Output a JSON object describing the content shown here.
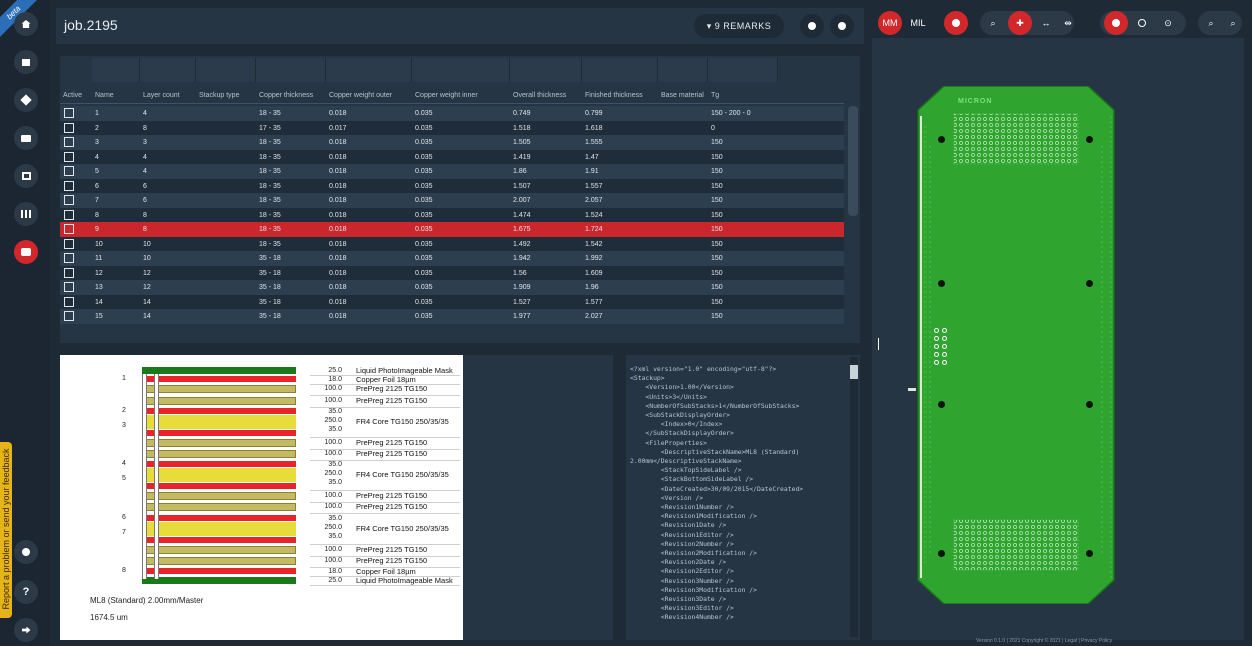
{
  "app": {
    "beta_label": "beta",
    "feedback_label": "Report a problem or send your feedback"
  },
  "sidebar": {
    "items": [
      {
        "icon": "home-icon"
      },
      {
        "icon": "document-icon"
      },
      {
        "icon": "layers-icon"
      },
      {
        "icon": "briefcase-icon"
      },
      {
        "icon": "board-icon"
      },
      {
        "icon": "grid-icon"
      },
      {
        "icon": "stackup-icon",
        "active": true
      }
    ],
    "bottom": [
      {
        "icon": "gear-icon"
      },
      {
        "icon": "help-icon",
        "label": "?"
      },
      {
        "icon": "logout-icon"
      }
    ]
  },
  "header": {
    "title": "job.2195",
    "remarks_label": "9 REMARKS"
  },
  "table": {
    "columns": [
      "Active",
      "Name",
      "Layer count",
      "Stackup type",
      "Copper thickness",
      "Copper weight outer",
      "Copper weight inner",
      "Overall thickness",
      "Finished thickness",
      "Base material",
      "Tg"
    ],
    "rows": [
      {
        "name": "1",
        "layers": "4",
        "stype": "",
        "cu_thk": "18 - 35",
        "cu_outer": "0.018",
        "cu_inner": "0.035",
        "overall": "0.749",
        "finished": "0.799",
        "base": "",
        "tg": "150 - 200 - 0"
      },
      {
        "name": "2",
        "layers": "8",
        "stype": "",
        "cu_thk": "17 - 35",
        "cu_outer": "0.017",
        "cu_inner": "0.035",
        "overall": "1.518",
        "finished": "1.618",
        "base": "",
        "tg": "0"
      },
      {
        "name": "3",
        "layers": "3",
        "stype": "",
        "cu_thk": "18 - 35",
        "cu_outer": "0.018",
        "cu_inner": "0.035",
        "overall": "1.505",
        "finished": "1.555",
        "base": "",
        "tg": "150"
      },
      {
        "name": "4",
        "layers": "4",
        "stype": "",
        "cu_thk": "18 - 35",
        "cu_outer": "0.018",
        "cu_inner": "0.035",
        "overall": "1.419",
        "finished": "1.47",
        "base": "",
        "tg": "150"
      },
      {
        "name": "5",
        "layers": "4",
        "stype": "",
        "cu_thk": "18 - 35",
        "cu_outer": "0.018",
        "cu_inner": "0.035",
        "overall": "1.86",
        "finished": "1.91",
        "base": "",
        "tg": "150"
      },
      {
        "name": "6",
        "layers": "6",
        "stype": "",
        "cu_thk": "18 - 35",
        "cu_outer": "0.018",
        "cu_inner": "0.035",
        "overall": "1.507",
        "finished": "1.557",
        "base": "",
        "tg": "150"
      },
      {
        "name": "7",
        "layers": "6",
        "stype": "",
        "cu_thk": "18 - 35",
        "cu_outer": "0.018",
        "cu_inner": "0.035",
        "overall": "2.007",
        "finished": "2.057",
        "base": "",
        "tg": "150"
      },
      {
        "name": "8",
        "layers": "8",
        "stype": "",
        "cu_thk": "18 - 35",
        "cu_outer": "0.018",
        "cu_inner": "0.035",
        "overall": "1.474",
        "finished": "1.524",
        "base": "",
        "tg": "150"
      },
      {
        "name": "9",
        "layers": "8",
        "stype": "",
        "cu_thk": "18 - 35",
        "cu_outer": "0.018",
        "cu_inner": "0.035",
        "overall": "1.675",
        "finished": "1.724",
        "base": "",
        "tg": "150",
        "selected": true
      },
      {
        "name": "10",
        "layers": "10",
        "stype": "",
        "cu_thk": "18 - 35",
        "cu_outer": "0.018",
        "cu_inner": "0.035",
        "overall": "1.492",
        "finished": "1.542",
        "base": "",
        "tg": "150"
      },
      {
        "name": "11",
        "layers": "10",
        "stype": "",
        "cu_thk": "35 - 18",
        "cu_outer": "0.018",
        "cu_inner": "0.035",
        "overall": "1.942",
        "finished": "1.992",
        "base": "",
        "tg": "150"
      },
      {
        "name": "12",
        "layers": "12",
        "stype": "",
        "cu_thk": "35 - 18",
        "cu_outer": "0.018",
        "cu_inner": "0.035",
        "overall": "1.56",
        "finished": "1.609",
        "base": "",
        "tg": "150"
      },
      {
        "name": "13",
        "layers": "12",
        "stype": "",
        "cu_thk": "35 - 18",
        "cu_outer": "0.018",
        "cu_inner": "0.035",
        "overall": "1.909",
        "finished": "1.96",
        "base": "",
        "tg": "150"
      },
      {
        "name": "14",
        "layers": "14",
        "stype": "",
        "cu_thk": "35 - 18",
        "cu_outer": "0.018",
        "cu_inner": "0.035",
        "overall": "1.527",
        "finished": "1.577",
        "base": "",
        "tg": "150"
      },
      {
        "name": "15",
        "layers": "14",
        "stype": "",
        "cu_thk": "35 - 18",
        "cu_outer": "0.018",
        "cu_inner": "0.035",
        "overall": "1.977",
        "finished": "2.027",
        "base": "",
        "tg": "150"
      }
    ]
  },
  "stackup": {
    "layers": [
      {
        "kind": "mask",
        "thickness": "25.0",
        "material": "Liquid PhotoImageable Mask"
      },
      {
        "kind": "copper",
        "num": "1",
        "thickness": "18.0",
        "material": "Copper Foil 18µm"
      },
      {
        "kind": "pp",
        "thickness": "100.0",
        "material": "PrePreg 2125 TG150"
      },
      {
        "kind": "pp",
        "thickness": "100.0",
        "material": "PrePreg 2125 TG150"
      },
      {
        "kind": "core",
        "nums": [
          "2",
          "3"
        ],
        "thickness": [
          "35.0",
          "250.0",
          "35.0"
        ],
        "material": "FR4 Core TG150 250/35/35"
      },
      {
        "kind": "pp",
        "thickness": "100.0",
        "material": "PrePreg 2125 TG150"
      },
      {
        "kind": "pp",
        "thickness": "100.0",
        "material": "PrePreg 2125 TG150"
      },
      {
        "kind": "core",
        "nums": [
          "4",
          "5"
        ],
        "thickness": [
          "35.0",
          "250.0",
          "35.0"
        ],
        "material": "FR4 Core TG150 250/35/35"
      },
      {
        "kind": "pp",
        "thickness": "100.0",
        "material": "PrePreg 2125 TG150"
      },
      {
        "kind": "pp",
        "thickness": "100.0",
        "material": "PrePreg 2125 TG150"
      },
      {
        "kind": "core",
        "nums": [
          "6",
          "7"
        ],
        "thickness": [
          "35.0",
          "250.0",
          "35.0"
        ],
        "material": "FR4 Core TG150 250/35/35"
      },
      {
        "kind": "pp",
        "thickness": "100.0",
        "material": "PrePreg 2125 TG150"
      },
      {
        "kind": "pp",
        "thickness": "100.0",
        "material": "PrePreg 2125 TG150"
      },
      {
        "kind": "copper",
        "num": "8",
        "thickness": "18.0",
        "material": "Copper Foil 18µm"
      },
      {
        "kind": "mask",
        "thickness": "25.0",
        "material": "Liquid PhotoImageable Mask"
      }
    ],
    "name": "ML8 (Standard) 2.00mm/Master",
    "total": "1674.5 um",
    "colors": {
      "mask": "#1a7a1a",
      "copper": "#e8232a",
      "prepreg": "#c4ba64",
      "core": "#e6dc3a"
    }
  },
  "xml": {
    "lines": [
      "<?xml version=\"1.0\" encoding=\"utf-8\"?>",
      "<Stackup>",
      "    <Version>1.00</Version>",
      "    <Units>3</Units>",
      "    <NumberOfSubStacks>1</NumberOfSubStacks>",
      "    <SubStackDisplayOrder>",
      "        <Index>0</Index>",
      "    </SubStackDisplayOrder>",
      "    <FileProperties>",
      "        <DescriptiveStackName>ML8 (Standard)",
      "2.00mm</DescriptiveStackName>",
      "        <StackTopSideLabel />",
      "        <StackBottomSideLabel />",
      "        <DateCreated>30/09/2015</DateCreated>",
      "        <Version />",
      "        <Revision1Number />",
      "        <Revision1Modification />",
      "        <Revision1Date />",
      "        <Revision1Editor />",
      "        <Revision2Number />",
      "        <Revision2Modification />",
      "        <Revision2Date />",
      "        <Revision2Editor />",
      "        <Revision3Number />",
      "        <Revision3Modification />",
      "        <Revision3Date />",
      "        <Revision3Editor />",
      "        <Revision4Number />"
    ]
  },
  "viewer": {
    "unit_mm": "MM",
    "unit_mil": "MIL",
    "tools": [
      "zoom-icon",
      "move-icon",
      "horizontal-arrows-icon",
      "measure-icon",
      "dot-filled-icon",
      "dot-outline-icon",
      "target-icon",
      "zoom-in-icon",
      "zoom-out-icon"
    ],
    "board_color": "#2fa52f",
    "board_logo": "MICRON"
  },
  "accent": "#d2282b",
  "status_text": "Version 0.1.0 | 2021 Copyright © 2021 | Legal | Privacy Policy"
}
